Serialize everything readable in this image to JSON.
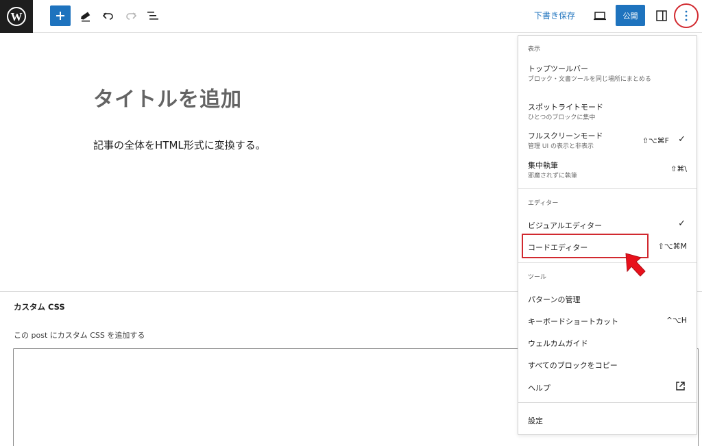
{
  "toolbar": {
    "logo": "wordpress-icon",
    "add_icon": "plus-icon",
    "tools_icon": "pencil-icon",
    "undo_icon": "undo-icon",
    "redo_icon": "redo-icon",
    "list_view_icon": "list-view-icon",
    "draft_save": "下書き保存",
    "preview_icon": "laptop-icon",
    "publish": "公開",
    "settings_icon": "sidebar-icon",
    "options_icon": "more-vertical-icon",
    "accent": "#1e73be"
  },
  "editor": {
    "title_placeholder": "タイトルを追加",
    "paragraph": "記事の全体をHTML形式に変換する。"
  },
  "custom_css": {
    "heading": "カスタム CSS",
    "help": "この post にカスタム CSS を追加する",
    "value": ""
  },
  "menu": {
    "view": {
      "heading": "表示",
      "items": [
        {
          "label": "トップツールバー",
          "desc": "ブロック・文書ツールを同じ場所にまとめる",
          "shortcut": "",
          "checked": false
        },
        {
          "label": "スポットライトモード",
          "desc": "ひとつのブロックに集中",
          "shortcut": "",
          "checked": false
        },
        {
          "label": "フルスクリーンモード",
          "desc": "管理 UI の表示と非表示",
          "shortcut": "⇧⌥⌘F",
          "checked": true
        },
        {
          "label": "集中執筆",
          "desc": "邪魔されずに執筆",
          "shortcut": "⇧⌘\\",
          "checked": false
        }
      ]
    },
    "editor": {
      "heading": "エディター",
      "items": [
        {
          "label": "ビジュアルエディター",
          "shortcut": "",
          "checked": true
        },
        {
          "label": "コードエディター",
          "shortcut": "⇧⌥⌘M",
          "checked": false
        }
      ]
    },
    "tools": {
      "heading": "ツール",
      "items": [
        {
          "label": "パターンの管理",
          "shortcut": ""
        },
        {
          "label": "キーボードショートカット",
          "shortcut": "^⌥H"
        },
        {
          "label": "ウェルカムガイド",
          "shortcut": ""
        },
        {
          "label": "すべてのブロックをコピー",
          "shortcut": ""
        },
        {
          "label": "ヘルプ",
          "shortcut": "",
          "icon": "external-link-icon"
        }
      ]
    },
    "settings": "設定",
    "check_mark": "✓",
    "highlight_color": "#d1292f"
  }
}
